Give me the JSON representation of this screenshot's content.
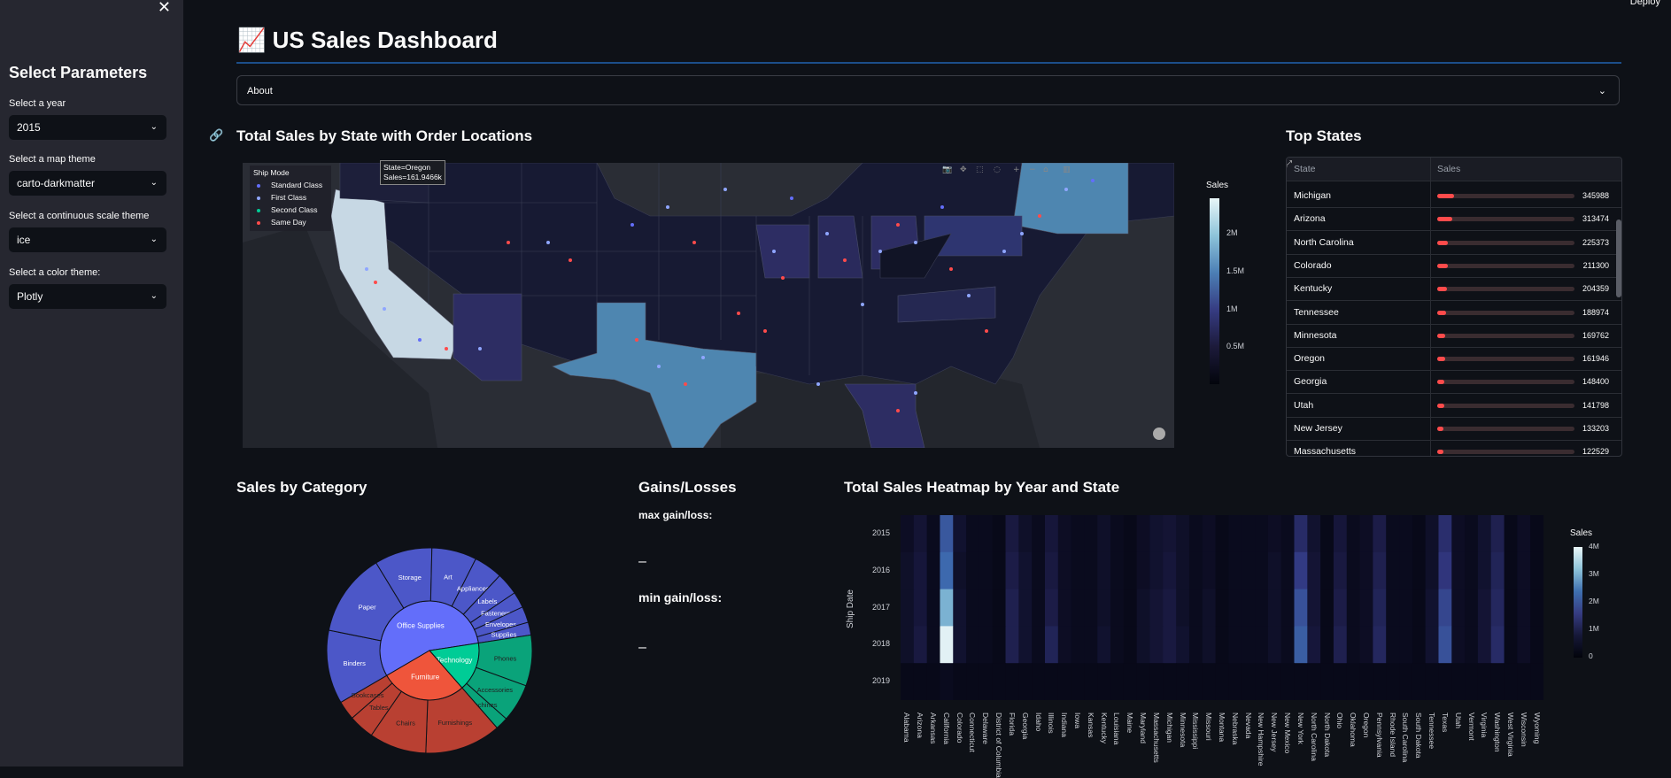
{
  "sidebar": {
    "title": "Select Parameters",
    "controls": [
      {
        "label": "Select a year",
        "value": "2015"
      },
      {
        "label": "Select a map theme",
        "value": "carto-darkmatter"
      },
      {
        "label": "Select a continuous scale theme",
        "value": "ice"
      },
      {
        "label": "Select a color theme:",
        "value": "Plotly"
      }
    ]
  },
  "header": {
    "deploy_label": "Deploy",
    "title": "📈 US Sales Dashboard",
    "about_label": "About"
  },
  "map_section": {
    "title": "Total Sales by State with Order Locations",
    "legend_title": "Ship Mode",
    "legend_items": [
      {
        "label": "Standard Class",
        "color": "#636efa"
      },
      {
        "label": "First Class",
        "color": "#8fa6ff"
      },
      {
        "label": "Second Class",
        "color": "#00cc96"
      },
      {
        "label": "Same Day",
        "color": "#ff4b4b"
      }
    ],
    "hover_line1": "State=Oregon",
    "hover_line2": "Sales=161.9466k",
    "colorbar_title": "Sales",
    "colorbar_ticks": [
      "2M",
      "1.5M",
      "1M",
      "0.5M"
    ]
  },
  "top_states": {
    "title": "Top States",
    "col_state": "State",
    "col_sales": "Sales",
    "rows": [
      {
        "state": "Michigan",
        "sales": 345988
      },
      {
        "state": "Arizona",
        "sales": 313474
      },
      {
        "state": "North Carolina",
        "sales": 225373
      },
      {
        "state": "Colorado",
        "sales": 211300
      },
      {
        "state": "Kentucky",
        "sales": 204359
      },
      {
        "state": "Tennessee",
        "sales": 188974
      },
      {
        "state": "Minnesota",
        "sales": 169762
      },
      {
        "state": "Oregon",
        "sales": 161946
      },
      {
        "state": "Georgia",
        "sales": 148400
      },
      {
        "state": "Utah",
        "sales": 141798
      },
      {
        "state": "New Jersey",
        "sales": 133203
      },
      {
        "state": "Massachusetts",
        "sales": 122529
      }
    ]
  },
  "category_section": {
    "title": "Sales by Category",
    "inner": [
      {
        "label": "Office Supplies",
        "color": "#636efa",
        "value": 0.56
      },
      {
        "label": "Technology",
        "color": "#00cc96",
        "value": 0.16
      },
      {
        "label": "Furniture",
        "color": "#ef553b",
        "value": 0.28
      }
    ],
    "outer": [
      {
        "label": "Binders",
        "value": 0.115,
        "color": "#4c57c8",
        "parent": 0
      },
      {
        "label": "Paper",
        "value": 0.13,
        "color": "#4c57c8",
        "parent": 0
      },
      {
        "label": "Storage",
        "value": 0.09,
        "color": "#4c57c8",
        "parent": 0
      },
      {
        "label": "Art",
        "value": 0.07,
        "color": "#4c57c8",
        "parent": 0
      },
      {
        "label": "Appliances",
        "value": 0.045,
        "color": "#4c57c8",
        "parent": 0
      },
      {
        "label": "Labels",
        "value": 0.035,
        "color": "#4c57c8",
        "parent": 0
      },
      {
        "label": "Fasteners",
        "value": 0.025,
        "color": "#4c57c8",
        "parent": 0
      },
      {
        "label": "Envelopes",
        "value": 0.025,
        "color": "#4c57c8",
        "parent": 0
      },
      {
        "label": "Supplies",
        "value": 0.02,
        "color": "#4c57c8",
        "parent": 0
      },
      {
        "label": "Furnishings",
        "value": 0.12,
        "color": "#b94032",
        "parent": 2
      },
      {
        "label": "Chairs",
        "value": 0.09,
        "color": "#b94032",
        "parent": 2
      },
      {
        "label": "Tables",
        "value": 0.04,
        "color": "#b94032",
        "parent": 2
      },
      {
        "label": "Bookcases",
        "value": 0.03,
        "color": "#b94032",
        "parent": 2
      },
      {
        "label": "Phones",
        "value": 0.08,
        "color": "#0aa37a",
        "parent": 1
      },
      {
        "label": "Accessories",
        "value": 0.06,
        "color": "#0aa37a",
        "parent": 1
      },
      {
        "label": "Machines",
        "value": 0.02,
        "color": "#0aa37a",
        "parent": 1
      }
    ]
  },
  "gains_section": {
    "title": "Gains/Losses",
    "max_label": "max gain/loss:",
    "max_value": "–",
    "min_label": "min gain/loss:",
    "min_value": "–"
  },
  "heatmap_section": {
    "title": "Total Sales Heatmap by Year and State",
    "ylabel": "Ship Date",
    "years": [
      "2015",
      "2016",
      "2017",
      "2018",
      "2019"
    ],
    "colorbar_title": "Sales",
    "colorbar_ticks": [
      "4M",
      "3M",
      "2M",
      "1M",
      "0"
    ],
    "states": [
      "Alabama",
      "Arizona",
      "Arkansas",
      "California",
      "Colorado",
      "Connecticut",
      "Delaware",
      "District of Columbia",
      "Florida",
      "Georgia",
      "Idaho",
      "Illinois",
      "Indiana",
      "Iowa",
      "Kansas",
      "Kentucky",
      "Louisiana",
      "Maine",
      "Maryland",
      "Massachusetts",
      "Michigan",
      "Minnesota",
      "Mississippi",
      "Missouri",
      "Montana",
      "Nebraska",
      "Nevada",
      "New Hampshire",
      "New Jersey",
      "New Mexico",
      "New York",
      "North Carolina",
      "North Dakota",
      "Ohio",
      "Oklahoma",
      "Oregon",
      "Pennsylvania",
      "Rhode Island",
      "South Carolina",
      "South Dakota",
      "Tennessee",
      "Texas",
      "Utah",
      "Vermont",
      "Virginia",
      "Washington",
      "West Virginia",
      "Wisconsin",
      "Wyoming"
    ],
    "chart_data": {
      "type": "heatmap",
      "x": [
        "Alabama",
        "Arizona",
        "Arkansas",
        "California",
        "Colorado",
        "Connecticut",
        "Delaware",
        "District of Columbia",
        "Florida",
        "Georgia",
        "Idaho",
        "Illinois",
        "Indiana",
        "Iowa",
        "Kansas",
        "Kentucky",
        "Louisiana",
        "Maine",
        "Maryland",
        "Massachusetts",
        "Michigan",
        "Minnesota",
        "Mississippi",
        "Missouri",
        "Montana",
        "Nebraska",
        "Nevada",
        "New Hampshire",
        "New Jersey",
        "New Mexico",
        "New York",
        "North Carolina",
        "North Dakota",
        "Ohio",
        "Oklahoma",
        "Oregon",
        "Pennsylvania",
        "Rhode Island",
        "South Carolina",
        "South Dakota",
        "Tennessee",
        "Texas",
        "Utah",
        "Vermont",
        "Virginia",
        "Washington",
        "West Virginia",
        "Wisconsin",
        "Wyoming"
      ],
      "y": [
        "2015",
        "2016",
        "2017",
        "2018",
        "2019"
      ],
      "zmax": 4.5,
      "z": [
        [
          0.2,
          0.5,
          0.1,
          2.1,
          0.4,
          0.1,
          0.1,
          0.0,
          0.7,
          0.3,
          0.1,
          0.6,
          0.2,
          0.1,
          0.1,
          0.3,
          0.1,
          0.0,
          0.2,
          0.4,
          0.5,
          0.3,
          0.1,
          0.2,
          0.0,
          0.1,
          0.1,
          0.1,
          0.2,
          0.1,
          1.2,
          0.4,
          0.0,
          0.6,
          0.1,
          0.2,
          0.8,
          0.1,
          0.1,
          0.0,
          0.3,
          1.3,
          0.2,
          0.1,
          0.4,
          0.9,
          0.0,
          0.2,
          0.0
        ],
        [
          0.3,
          0.6,
          0.1,
          2.4,
          0.3,
          0.1,
          0.1,
          0.0,
          0.8,
          0.4,
          0.1,
          0.7,
          0.2,
          0.1,
          0.1,
          0.3,
          0.1,
          0.0,
          0.2,
          0.4,
          0.6,
          0.3,
          0.1,
          0.2,
          0.0,
          0.1,
          0.1,
          0.1,
          0.3,
          0.1,
          1.6,
          0.5,
          0.0,
          0.7,
          0.1,
          0.2,
          0.9,
          0.1,
          0.1,
          0.0,
          0.3,
          1.5,
          0.2,
          0.1,
          0.4,
          1.0,
          0.0,
          0.2,
          0.0
        ],
        [
          0.3,
          0.6,
          0.1,
          3.2,
          0.4,
          0.1,
          0.1,
          0.0,
          0.9,
          0.4,
          0.1,
          0.8,
          0.2,
          0.1,
          0.1,
          0.3,
          0.1,
          0.0,
          0.3,
          0.5,
          0.7,
          0.3,
          0.1,
          0.3,
          0.0,
          0.1,
          0.1,
          0.1,
          0.3,
          0.1,
          2.0,
          0.5,
          0.0,
          0.8,
          0.1,
          0.2,
          1.0,
          0.1,
          0.1,
          0.0,
          0.4,
          1.8,
          0.2,
          0.1,
          0.5,
          1.1,
          0.0,
          0.2,
          0.0
        ],
        [
          0.3,
          0.7,
          0.1,
          4.4,
          0.4,
          0.1,
          0.1,
          0.0,
          0.9,
          0.4,
          0.1,
          1.0,
          0.2,
          0.1,
          0.1,
          0.4,
          0.1,
          0.0,
          0.3,
          0.5,
          0.7,
          0.4,
          0.1,
          0.3,
          0.0,
          0.1,
          0.1,
          0.1,
          0.3,
          0.1,
          2.2,
          0.6,
          0.0,
          0.9,
          0.1,
          0.2,
          1.1,
          0.1,
          0.1,
          0.0,
          0.4,
          2.0,
          0.2,
          0.1,
          0.5,
          1.2,
          0.0,
          0.2,
          0.0
        ],
        [
          0.0,
          0.0,
          0.0,
          0.1,
          0.0,
          0.0,
          0.0,
          0.0,
          0.0,
          0.0,
          0.0,
          0.0,
          0.0,
          0.0,
          0.0,
          0.0,
          0.0,
          0.0,
          0.0,
          0.0,
          0.0,
          0.0,
          0.0,
          0.0,
          0.0,
          0.0,
          0.0,
          0.0,
          0.0,
          0.0,
          0.0,
          0.0,
          0.0,
          0.0,
          0.0,
          0.0,
          0.0,
          0.0,
          0.0,
          0.0,
          0.0,
          0.0,
          0.0,
          0.0,
          0.0,
          0.0,
          0.0,
          0.0,
          0.0
        ]
      ]
    }
  }
}
